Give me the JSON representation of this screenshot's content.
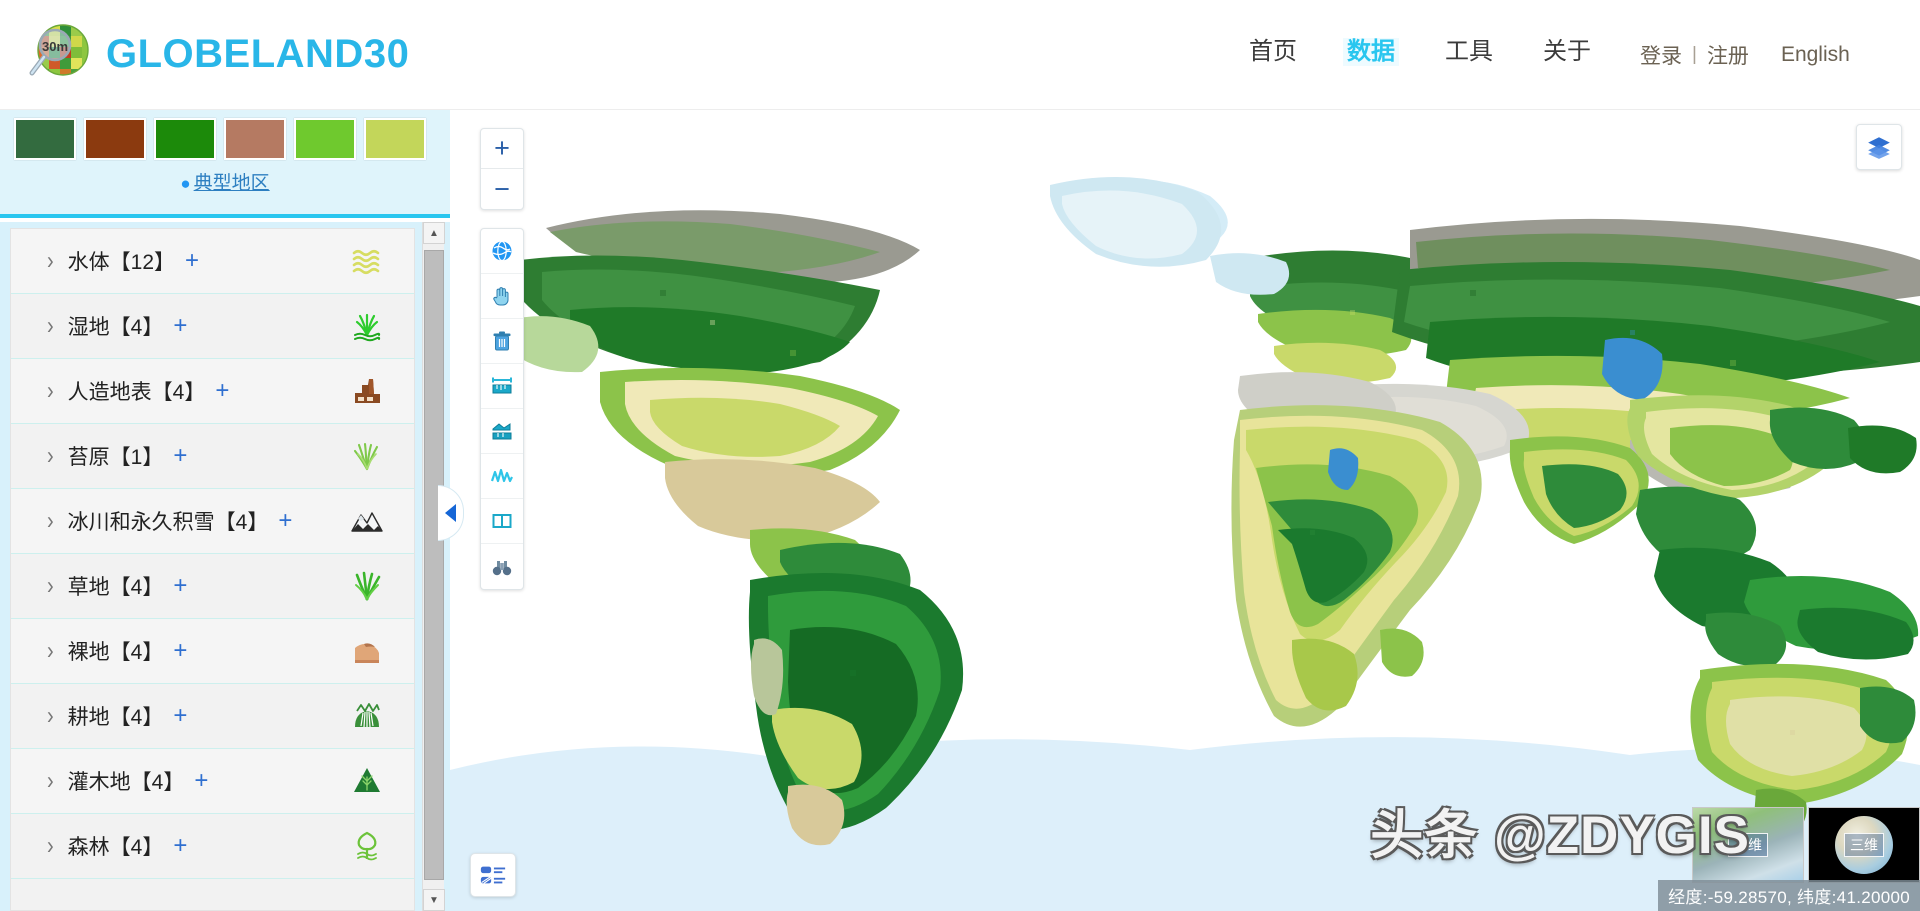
{
  "header": {
    "logo_text": "GLOBELAND30",
    "logo_badge": "30m",
    "logo_icon": "globe-magnifier-icon",
    "nav": [
      {
        "label": "首页",
        "active": false
      },
      {
        "label": "数据",
        "active": true
      },
      {
        "label": "工具",
        "active": false
      },
      {
        "label": "关于",
        "active": false
      }
    ],
    "login_label": "登录",
    "separator": "|",
    "register_label": "注册",
    "language_label": "English"
  },
  "sidebar": {
    "swatches": [
      "#336b3f",
      "#8b3a0f",
      "#1c8a0a",
      "#b57a62",
      "#6fc92e",
      "#c3d65a"
    ],
    "typical_region_label": "典型地区",
    "typical_region_icon": "location-pin-icon",
    "collapse_icon": "chevron-left-icon",
    "layers": [
      {
        "name": "水体",
        "count": "【12】",
        "plus": "+",
        "icon": "water-waves-icon"
      },
      {
        "name": "湿地",
        "count": "【4】",
        "plus": "+",
        "icon": "wetland-reed-icon"
      },
      {
        "name": "人造地表",
        "count": "【4】",
        "plus": "+",
        "icon": "factory-building-icon"
      },
      {
        "name": "苔原",
        "count": "【1】",
        "plus": "+",
        "icon": "tundra-grass-icon"
      },
      {
        "name": "冰川和永久积雪",
        "count": "【4】",
        "plus": "+",
        "icon": "snow-mountain-icon"
      },
      {
        "name": "草地",
        "count": "【4】",
        "plus": "+",
        "icon": "grass-icon"
      },
      {
        "name": "裸地",
        "count": "【4】",
        "plus": "+",
        "icon": "bare-land-icon"
      },
      {
        "name": "耕地",
        "count": "【4】",
        "plus": "+",
        "icon": "cultivated-field-icon"
      },
      {
        "name": "灌木地",
        "count": "【4】",
        "plus": "+",
        "icon": "shrub-tree-icon"
      },
      {
        "name": "森林",
        "count": "【4】",
        "plus": "+",
        "icon": "forest-tree-icon"
      }
    ],
    "scrollbar": {
      "up_glyph": "▲",
      "down_glyph": "▼"
    }
  },
  "map": {
    "zoom_in_label": "+",
    "zoom_out_label": "−",
    "tools": [
      {
        "icon": "globe-3d-icon"
      },
      {
        "icon": "pan-hand-icon"
      },
      {
        "icon": "trash-clear-icon"
      },
      {
        "icon": "measure-distance-icon"
      },
      {
        "icon": "measure-area-icon"
      },
      {
        "icon": "profile-wave-icon"
      },
      {
        "icon": "swipe-compare-icon"
      },
      {
        "icon": "binoculars-search-icon"
      }
    ],
    "layers_button_icon": "layers-stack-icon",
    "legend_button_icon": "legend-list-icon",
    "thumb_2d_label": "二维",
    "thumb_3d_label": "三维",
    "coordinates": "经度:-59.28570, 纬度:41.20000",
    "watermark": "头条 @ZDYGIS"
  }
}
